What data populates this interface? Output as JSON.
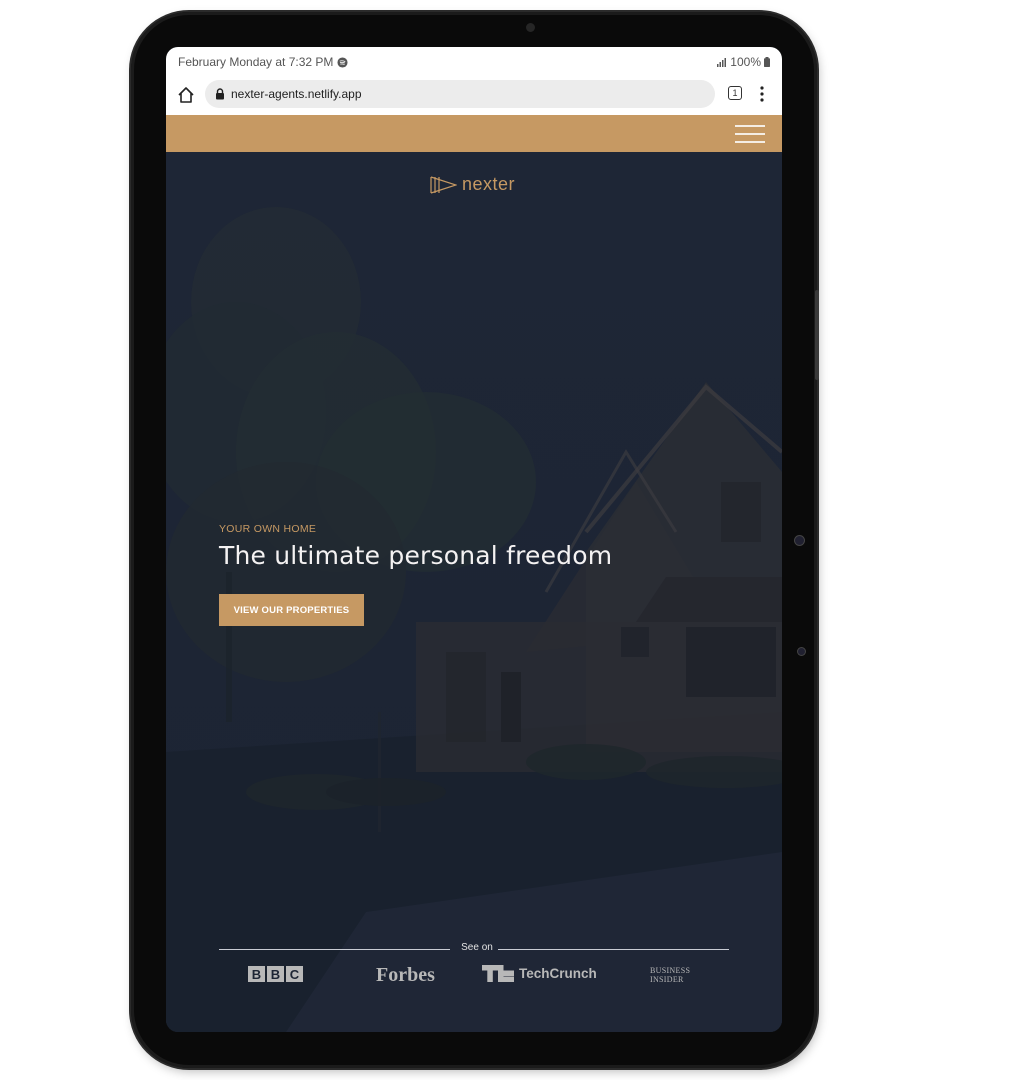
{
  "status_bar": {
    "time": "February Monday at 7:32 PM",
    "battery": "100%"
  },
  "browser": {
    "url": "nexter-agents.netlify.app",
    "tab_count": "1"
  },
  "site": {
    "logo_text": "nexter",
    "hero": {
      "subtitle": "Your own home",
      "title": "The ultimate personal freedom",
      "button_label": "View our properties"
    },
    "seen_on": {
      "label": "See on",
      "logos": {
        "bbc": [
          "B",
          "B",
          "C"
        ],
        "forbes": "Forbes",
        "techcrunch": "TechCrunch",
        "business_insider_line1": "BUSINESS",
        "business_insider_line2": "INSIDER"
      }
    }
  },
  "colors": {
    "accent": "#c69963",
    "hero_overlay": "#1d2534",
    "device_frame": "#0a0a0a"
  }
}
